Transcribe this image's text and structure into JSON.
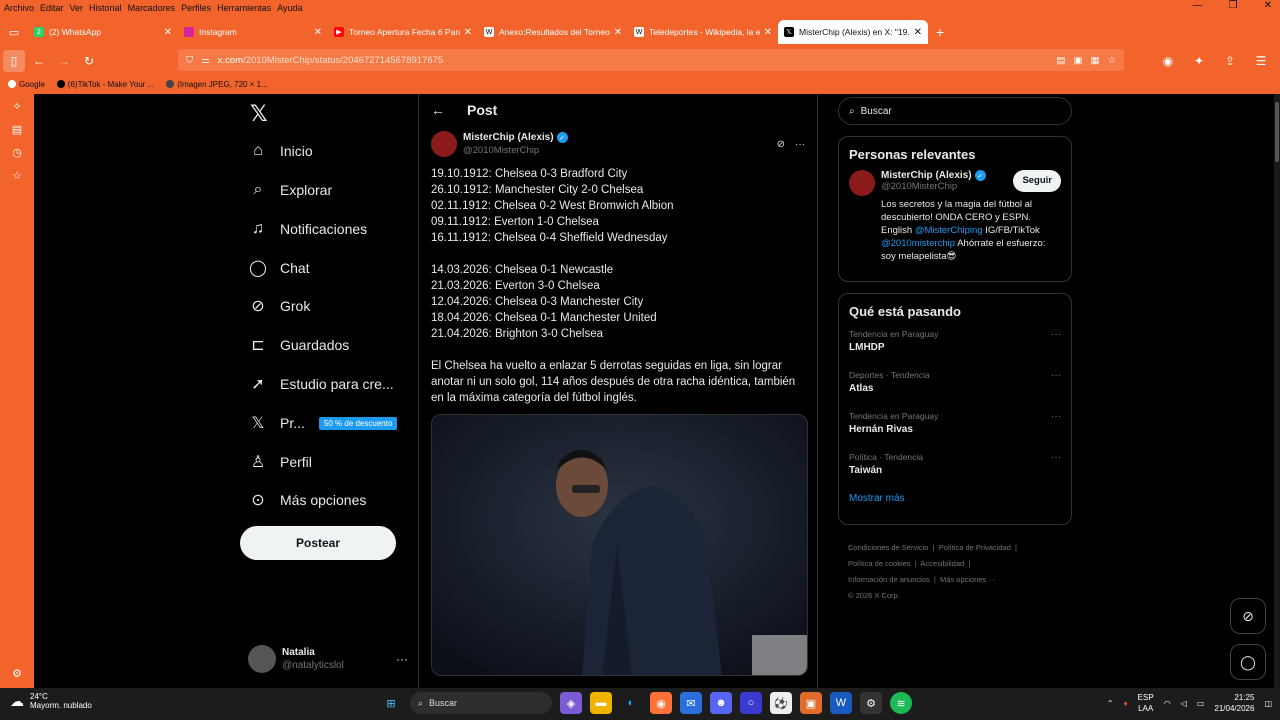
{
  "menubar": [
    "Archivo",
    "Editar",
    "Ver",
    "Historial",
    "Marcadores",
    "Perfiles",
    "Herramientas",
    "Ayuda"
  ],
  "tabs": [
    {
      "title": "(2) WhatsApp",
      "icon": "whatsapp-icon",
      "color": "#25d366",
      "fav_text": "2"
    },
    {
      "title": "Instagram",
      "icon": "instagram-icon",
      "color": "#d6249f",
      "fav_text": ""
    },
    {
      "title": "Torneo Apertura Fecha 6 Paragu",
      "icon": "youtube-icon",
      "color": "#ff0000",
      "fav_text": "▶"
    },
    {
      "title": "Anexo:Resultados del Torneo A",
      "icon": "wikipedia-icon",
      "color": "#ffffff",
      "fav_text": "W"
    },
    {
      "title": "Teledeportes - Wikipedia, la enc",
      "icon": "wikipedia-icon",
      "color": "#ffffff",
      "fav_text": "W"
    },
    {
      "title": "MisterChip (Alexis) en X: \"19.10.",
      "icon": "x-icon",
      "color": "#000000",
      "fav_text": "𝕏",
      "active": true
    }
  ],
  "url": {
    "host": "x.com",
    "path": "/2010MisterChip/status/2046727145678917675"
  },
  "bookmarks": [
    "Google",
    "(6)TikTok - Make Your ...",
    "(Imagen JPEG, 720 × 1..."
  ],
  "nav": {
    "items": [
      "Inicio",
      "Explorar",
      "Notificaciones",
      "Chat",
      "Grok",
      "Guardados",
      "Estudio para cre...",
      "Pr...",
      "Perfil",
      "Más opciones"
    ],
    "promo": "50 % de descuento",
    "post_button": "Postear",
    "account": {
      "name": "Natalia",
      "handle": "@natalyticslol"
    }
  },
  "post": {
    "header": "Post",
    "author": {
      "name": "MisterChip (Alexis)",
      "handle": "@2010MisterChip"
    },
    "lines_a": [
      "19.10.1912: Chelsea 0-3 Bradford City",
      "26.10.1912: Manchester City 2-0 Chelsea",
      "02.11.1912: Chelsea 0-2 West Bromwich Albion",
      "09.11.1912: Everton 1-0 Chelsea",
      "16.11.1912: Chelsea 0-4 Sheffield Wednesday"
    ],
    "lines_b": [
      "14.03.2026: Chelsea 0-1 Newcastle",
      "21.03.2026: Everton 3-0 Chelsea",
      "12.04.2026: Chelsea 0-3 Manchester City",
      "18.04.2026: Chelsea 0-1 Manchester United",
      "21.04.2026: Brighton 3-0 Chelsea"
    ],
    "paragraph": "El Chelsea ha vuelto a enlazar 5 derrotas seguidas en liga, sin lograr anotar ni un solo gol, 114 años después de otra racha idéntica, también en la máxima categoría del fútbol inglés."
  },
  "right": {
    "search_placeholder": "Buscar",
    "relevant_title": "Personas relevantes",
    "relevant": {
      "name": "MisterChip (Alexis)",
      "handle": "@2010MisterChip",
      "follow": "Seguir",
      "bio_1": "Los secretos y la magia del fútbol al descubierto! ONDA CERO y ESPN. English ",
      "bio_link_1": "@MisterChiping",
      "bio_2": " IG/FB/TikTok ",
      "bio_link_2": "@2010misterchip",
      "bio_3": " Ahórrate el esfuerzo: soy melapelista😎"
    },
    "trending_title": "Qué está pasando",
    "trends": [
      {
        "context": "Tendencia en Paraguay",
        "topic": "LMHDP"
      },
      {
        "context": "Deportes · Tendencia",
        "topic": "Atlas"
      },
      {
        "context": "Tendencia en Paraguay",
        "topic": "Hernán Rivas"
      },
      {
        "context": "Política · Tendencia",
        "topic": "Taiwán"
      }
    ],
    "show_more": "Mostrar más",
    "footer": {
      "terms": "Condiciones de Servicio",
      "privacy": "Política de Privacidad",
      "cookies": "Política de cookies",
      "accessibility": "Accesibilidad",
      "ads": "Información de anuncios",
      "more": "Más opciones ···",
      "copyright": "© 2026 X Corp."
    }
  },
  "taskbar": {
    "temp": "24°C",
    "weather": "Mayorm. nublado",
    "search": "Buscar",
    "lang_1": "ESP",
    "lang_2": "LAA",
    "time": "21:25",
    "date": "21/04/2026"
  }
}
